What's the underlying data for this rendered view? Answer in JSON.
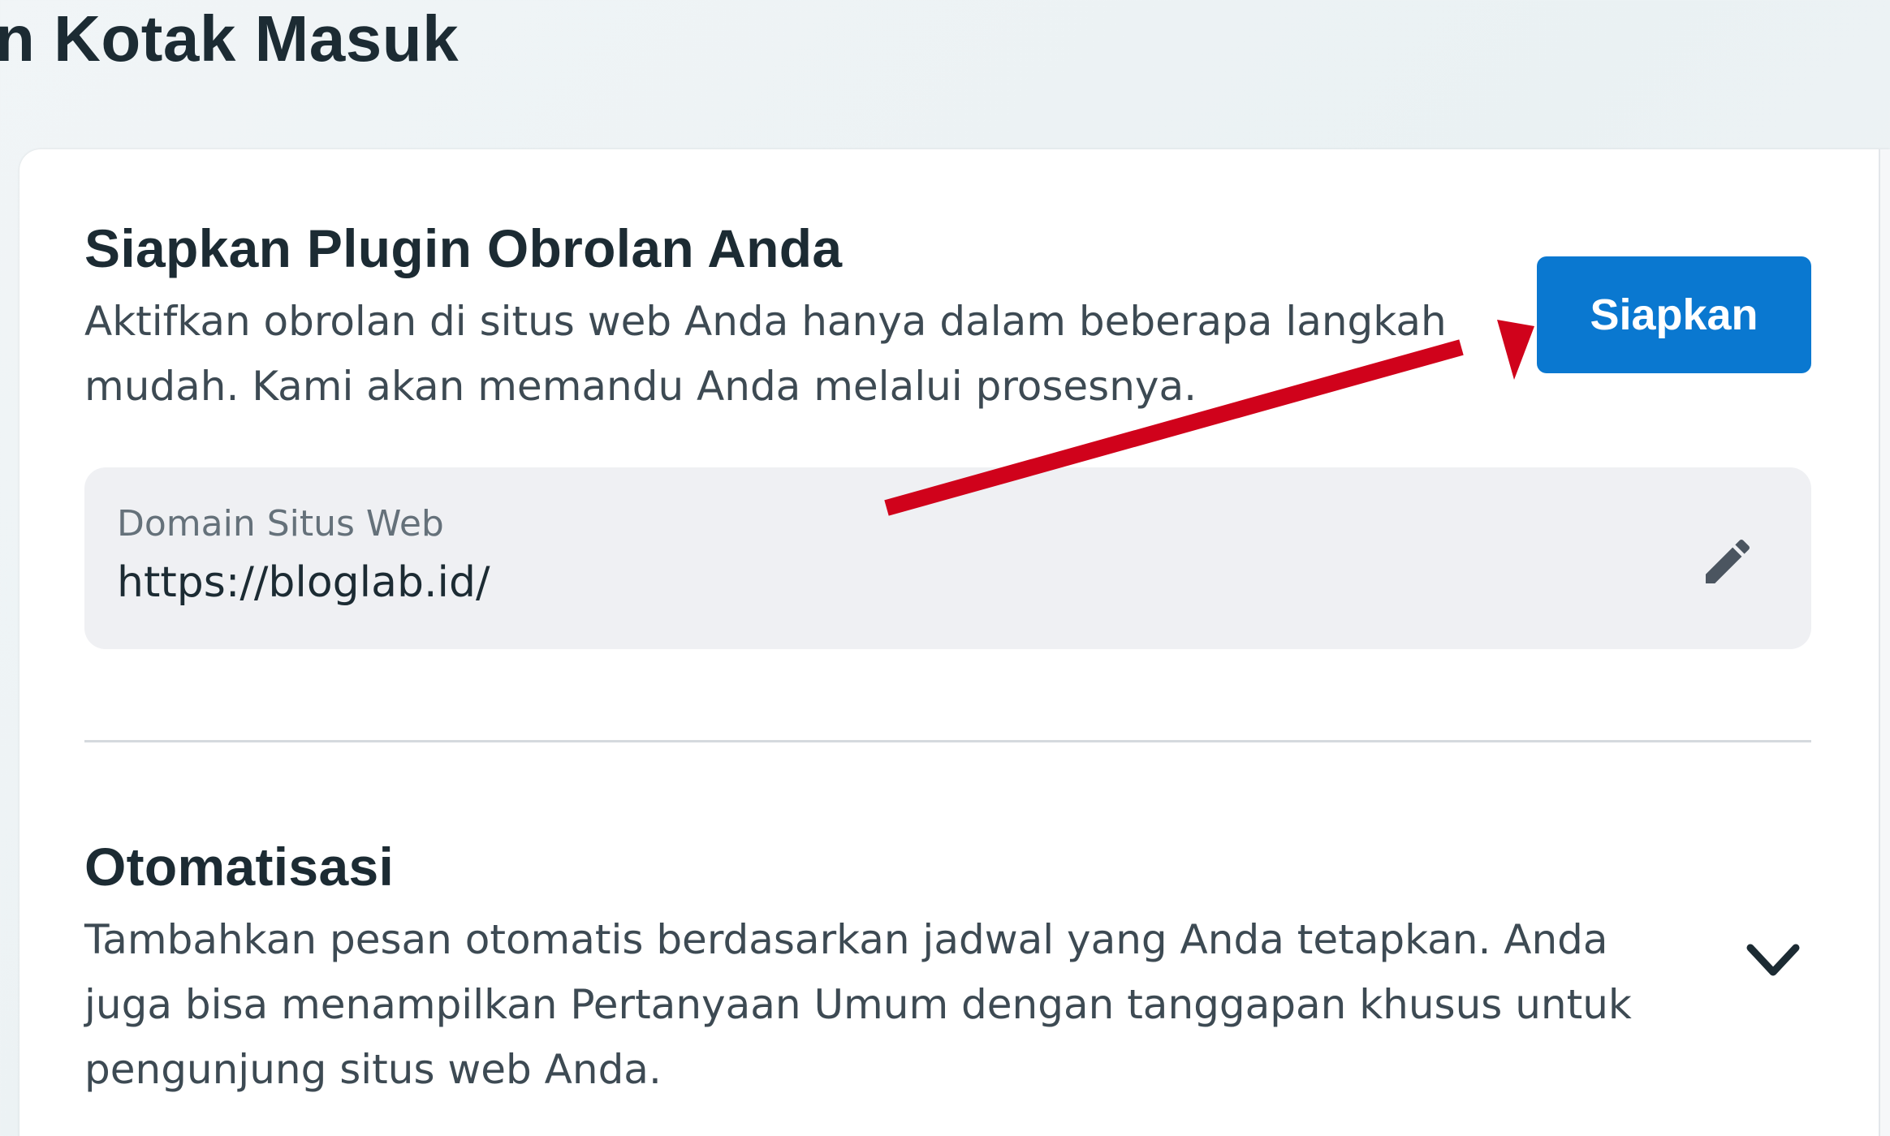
{
  "header": {
    "title": "n Kotak Masuk"
  },
  "setup_section": {
    "title": "Siapkan Plugin Obrolan Anda",
    "description": "Aktifkan obrolan di situs web Anda hanya dalam beberapa langkah mudah. Kami akan memandu Anda melalui prosesnya.",
    "button_label": "Siapkan",
    "button_color": "#0a78d0"
  },
  "domain_field": {
    "label": "Domain Situs Web",
    "value": "https://bloglab.id/",
    "edit_icon": "pencil-icon"
  },
  "automation_section": {
    "title": "Otomatisasi",
    "description": "Tambahkan pesan otomatis berdasarkan jadwal yang Anda tetapkan. Anda juga bisa menampilkan Pertanyaan Umum dengan tanggapan khusus untuk pengunjung situs web Anda.",
    "expand_icon": "chevron-down-icon"
  },
  "annotation": {
    "arrow_color": "#d0021b"
  }
}
